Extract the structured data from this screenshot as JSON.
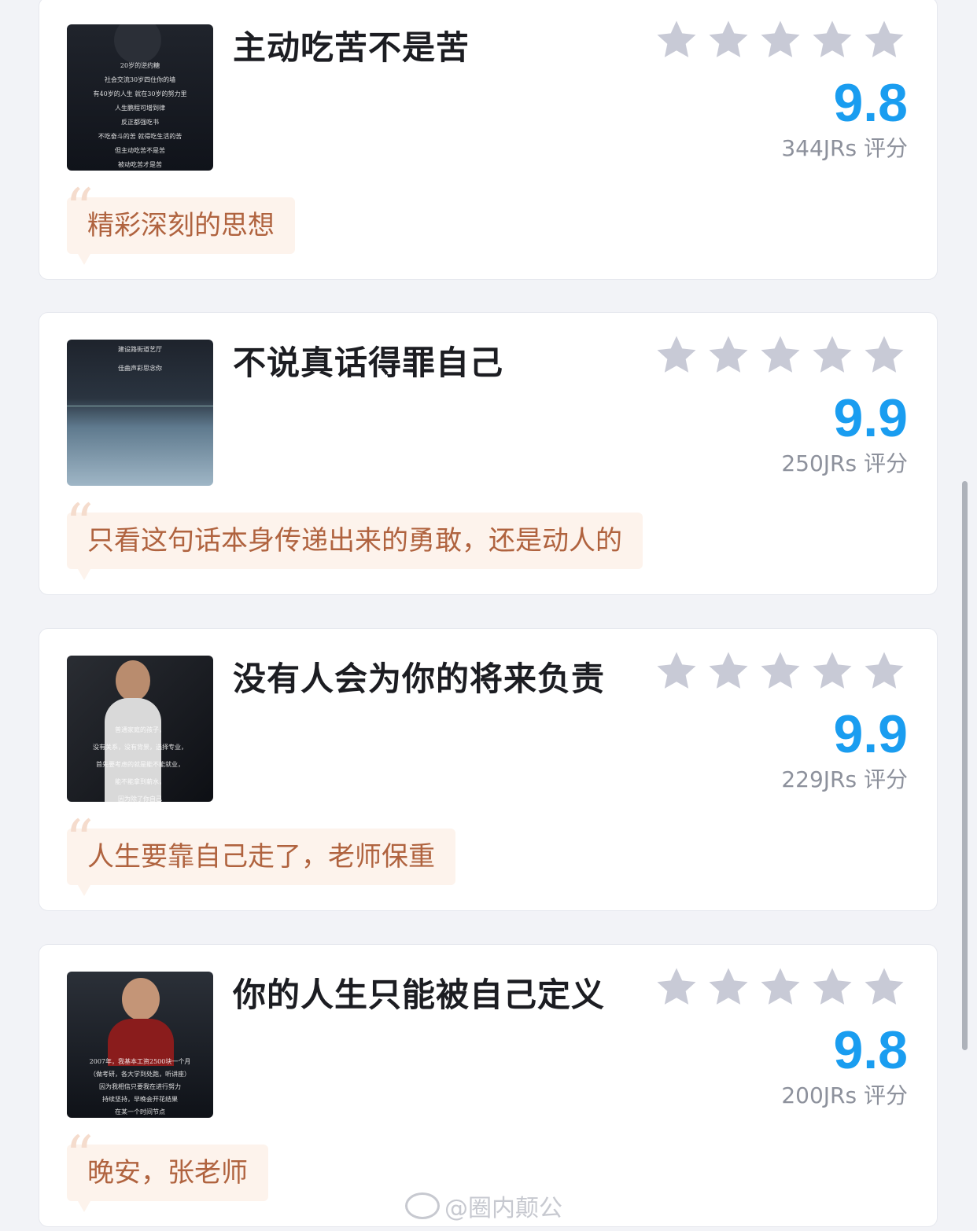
{
  "cards": [
    {
      "title": "主动吃苦不是苦",
      "score": "9.8",
      "count": "344JRs 评分",
      "quote": "精彩深刻的思想",
      "thumb_lines": [
        "20岁的逆约糖",
        "社会交流30岁四住你的墙",
        "有40岁的人生 就在30岁的努力里",
        "人生鹏程可增到律",
        "反正都强吃书",
        "不吃奋斗的苦 就得吃生活的苦",
        "但主动吃苦不是苦",
        "被动吃苦才是苦"
      ]
    },
    {
      "title": "不说真话得罪自己",
      "score": "9.9",
      "count": "250JRs 评分",
      "quote": "只看这句话本身传递出来的勇敢，还是动人的",
      "thumb_lines": [
        "建设路街道艺厅",
        "佳曲声彩思念你"
      ]
    },
    {
      "title": "没有人会为你的将来负责",
      "score": "9.9",
      "count": "229JRs 评分",
      "quote": "人生要靠自己走了，老师保重",
      "thumb_lines": [
        "普通家庭的孩子，",
        "没有关系，没有背景，选择专业，",
        "首先要考虑的就是能不能就业，",
        "能不能拿到薪水，",
        "因为除了你自己"
      ]
    },
    {
      "title": "你的人生只能被自己定义",
      "score": "9.8",
      "count": "200JRs 评分",
      "quote": "晚安，张老师",
      "thumb_lines": [
        "2007年，我基本工资2500块一个月",
        "（做考研，各大学到处跑，听讲座）",
        "因为我相信只要我在进行努力",
        "持续坚持，早晚会开花结果",
        "在某一个时间节点"
      ]
    }
  ],
  "watermark": "@圈内颠公",
  "colors": {
    "score": "#1a9df0",
    "star": "#c8cad6",
    "quote_bg": "#fdf3ec",
    "quote_text": "#b0633f"
  },
  "icons": {
    "star": "star-icon",
    "quote": "quote-mark-icon",
    "watermark": "weibo-icon"
  }
}
